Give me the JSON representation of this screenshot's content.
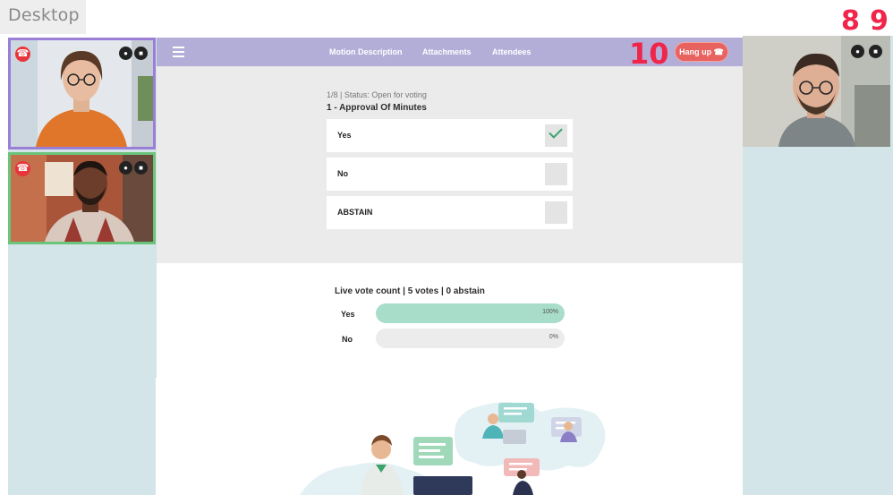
{
  "desktop_label": "Desktop",
  "step_markers": {
    "eight": "8",
    "nine": "9",
    "ten": "10"
  },
  "colors": {
    "topbar": "#b3aed8",
    "hangup": "#e8625f",
    "tile_1_border": "#9b7fd6",
    "tile_2_border": "#6cc47a",
    "side_panel": "#d4e5e9",
    "vote_bar_fill": "#a8ddc9",
    "step_marker": "#f0254a"
  },
  "nav": {
    "menu_icon": "hamburger-icon",
    "links": [
      "Motion Description",
      "Attachments",
      "Attendees"
    ],
    "hangup_label": "Hang up"
  },
  "motion": {
    "status": "1/8 | Status: Open for voting",
    "title": "1 - Approval Of Minutes",
    "options": [
      {
        "label": "Yes",
        "selected": true
      },
      {
        "label": "No",
        "selected": false
      },
      {
        "label": "ABSTAIN",
        "selected": false
      }
    ]
  },
  "vote_count": {
    "title": "Live vote count | 5 votes | 0 abstain",
    "bars": [
      {
        "label": "Yes",
        "percent": 100,
        "percent_text": "100%"
      },
      {
        "label": "No",
        "percent": 0,
        "percent_text": "0%"
      }
    ]
  },
  "videos": {
    "icons": [
      "hang-up-icon",
      "microphone-icon",
      "camera-icon"
    ]
  }
}
